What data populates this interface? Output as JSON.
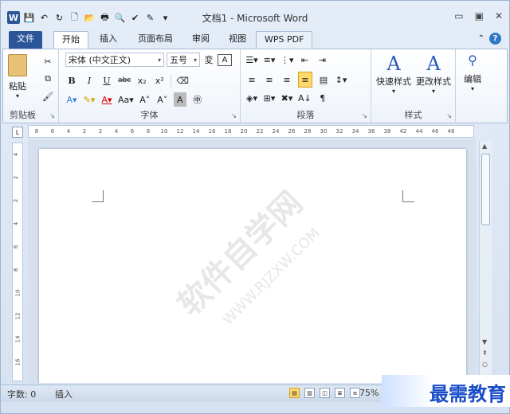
{
  "window": {
    "title": "文档1 - Microsoft Word"
  },
  "tabs": [
    {
      "label": "文件"
    },
    {
      "label": "开始"
    },
    {
      "label": "插入"
    },
    {
      "label": "页面布局"
    },
    {
      "label": "审阅"
    },
    {
      "label": "视图"
    },
    {
      "label": "WPS PDF"
    }
  ],
  "ribbon": {
    "clipboard": {
      "label": "剪贴板",
      "paste": "粘贴"
    },
    "font": {
      "label": "字体",
      "font_name": "宋体 (中文正文)",
      "font_size": "五号"
    },
    "paragraph": {
      "label": "段落"
    },
    "styles": {
      "label": "样式",
      "quick": "快速样式",
      "change": "更改样式"
    },
    "editing": {
      "label": "编辑"
    }
  },
  "ruler": {
    "ticks": [
      "8",
      "6",
      "4",
      "2",
      "2",
      "4",
      "6",
      "8",
      "10",
      "12",
      "14",
      "16",
      "18",
      "20",
      "22",
      "24",
      "26",
      "28",
      "30",
      "32",
      "34",
      "36",
      "38",
      "42",
      "44",
      "46",
      "48"
    ]
  },
  "vruler": {
    "ticks": [
      "4",
      "2",
      "2",
      "4",
      "6",
      "8",
      "10",
      "12",
      "14",
      "16"
    ]
  },
  "document": {
    "watermark": "软件自学网",
    "watermark_url": "WWW.RJZXW.COM"
  },
  "status": {
    "words": "字数: 0",
    "mode": "插入",
    "zoom": "75%"
  },
  "brand": {
    "text": "最需教育"
  }
}
